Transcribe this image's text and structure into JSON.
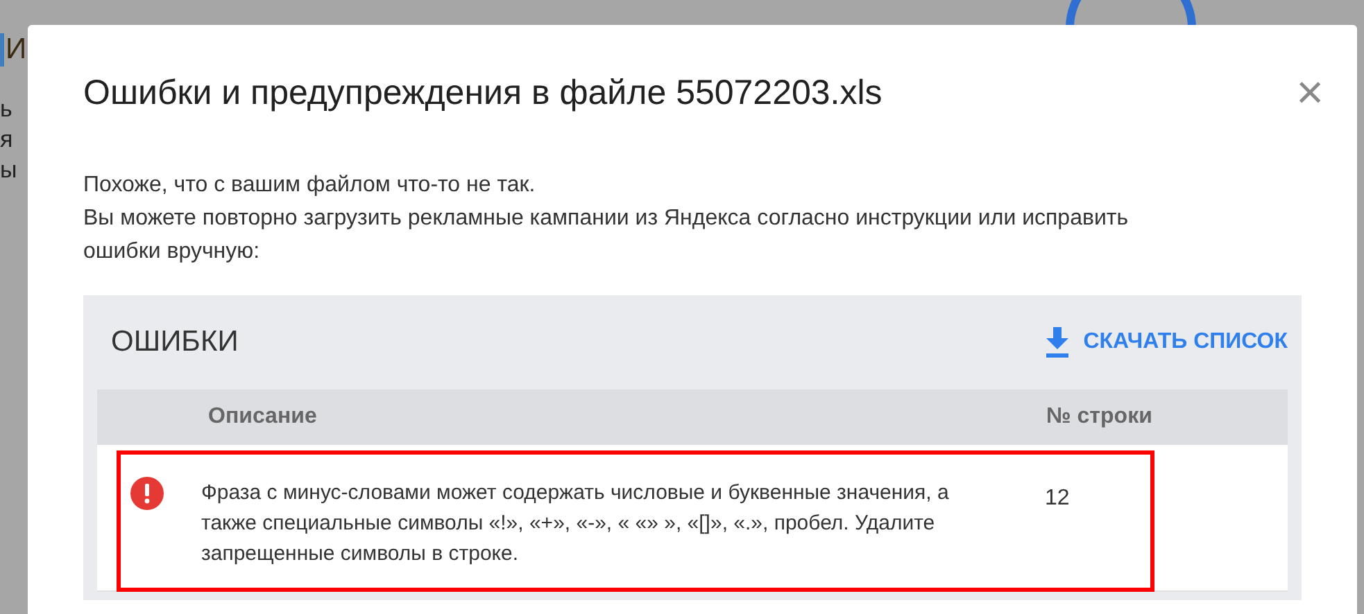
{
  "background_page": {
    "title": "И",
    "lines": [
      "ь",
      "я",
      "ы"
    ]
  },
  "dialog": {
    "title": "Ошибки и предупреждения в файле 55072203.xls",
    "close": "×",
    "intro": [
      "Похоже, что с вашим файлом что-то не так.",
      "Вы можете повторно загрузить рекламные кампании из Яндекса согласно инструкции или исправить ошибки вручную:"
    ],
    "errors_panel": {
      "title": "ОШИБКИ",
      "download_button": "СКАЧАТЬ СПИСОК",
      "table": {
        "columns": [
          "Описание",
          "№ строки"
        ],
        "rows": [
          {
            "kind": "error",
            "description": "Фраза с минус-словами может содержать числовые и буквенные значения, а также специальные символы «!», «+», «-», « «» », «[]», «.», пробел. Удалите запрещенные символы в строке.",
            "line": "12",
            "highlighted": true
          }
        ]
      }
    }
  }
}
